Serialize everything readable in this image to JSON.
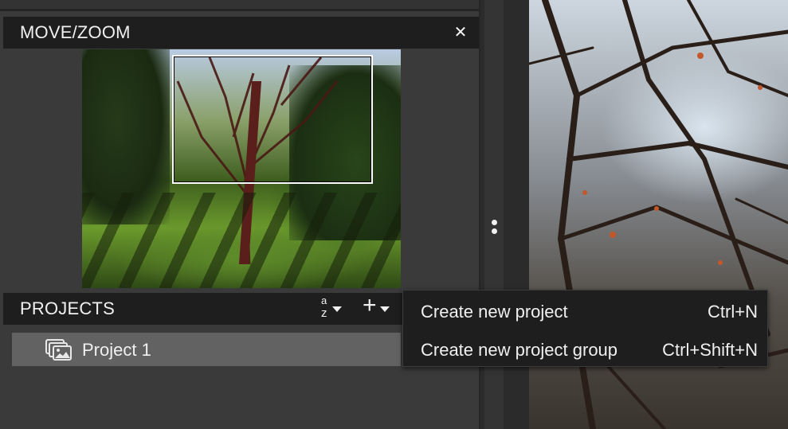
{
  "move_zoom": {
    "title": "MOVE/ZOOM",
    "close_glyph": "✕"
  },
  "projects": {
    "title": "PROJECTS",
    "sort_top": "a",
    "sort_bottom": "z",
    "add_glyph": "+",
    "items": [
      {
        "label": "Project 1",
        "icon": "project-images-icon"
      }
    ]
  },
  "context_menu": {
    "items": [
      {
        "label": "Create new project",
        "shortcut": "Ctrl+N"
      },
      {
        "label": "Create new project group",
        "shortcut": "Ctrl+Shift+N"
      }
    ]
  },
  "colors": {
    "panel_bg": "#3a3a3a",
    "header_bg": "#1e1e1e",
    "selected_item": "#626262",
    "menu_bg": "#1e1e1e",
    "text": "#f0f0f0"
  }
}
